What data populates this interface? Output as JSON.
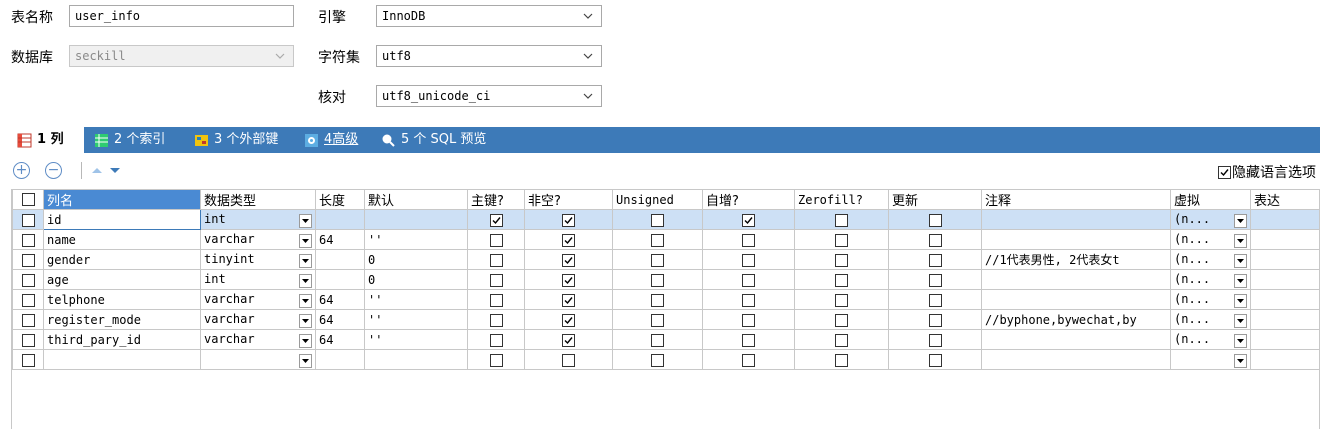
{
  "form": {
    "table_name_label": "表名称",
    "table_name_value": "user_info",
    "database_label": "数据库",
    "database_value": "seckill",
    "engine_label": "引擎",
    "engine_value": "InnoDB",
    "charset_label": "字符集",
    "charset_value": "utf8",
    "collation_label": "核对",
    "collation_value": "utf8_unicode_ci"
  },
  "tabs": [
    {
      "label": "1 列",
      "icon": "columns-icon"
    },
    {
      "label": "2 个索引",
      "icon": "index-icon"
    },
    {
      "label": "3 个外部键",
      "icon": "foreign-key-icon"
    },
    {
      "label": "4高级",
      "icon": "advanced-icon"
    },
    {
      "label": "5 个 SQL 预览",
      "icon": "search-icon"
    }
  ],
  "toolbar": {
    "add_glyph": "+",
    "remove_glyph": "−",
    "hide_lang_label": "隐藏语言选项"
  },
  "columns": [
    "列名",
    "数据类型",
    "长度",
    "默认",
    "主键?",
    "非空?",
    "Unsigned",
    "自增?",
    "Zerofill?",
    "更新",
    "注释",
    "虚拟",
    "表达"
  ],
  "rows": [
    {
      "name": "id",
      "type": "int",
      "length": "",
      "default": "",
      "pk": true,
      "notnull": true,
      "unsigned": false,
      "autoinc": true,
      "zerofill": false,
      "update": false,
      "comment": "",
      "virtual": "(n..."
    },
    {
      "name": "name",
      "type": "varchar",
      "length": "64",
      "default": "''",
      "pk": false,
      "notnull": true,
      "unsigned": false,
      "autoinc": false,
      "zerofill": false,
      "update": false,
      "comment": "",
      "virtual": "(n..."
    },
    {
      "name": "gender",
      "type": "tinyint",
      "length": "",
      "default": "0",
      "pk": false,
      "notnull": true,
      "unsigned": false,
      "autoinc": false,
      "zerofill": false,
      "update": false,
      "comment": "//1代表男性, 2代表女t",
      "virtual": "(n..."
    },
    {
      "name": "age",
      "type": "int",
      "length": "",
      "default": "0",
      "pk": false,
      "notnull": true,
      "unsigned": false,
      "autoinc": false,
      "zerofill": false,
      "update": false,
      "comment": "",
      "virtual": "(n..."
    },
    {
      "name": "telphone",
      "type": "varchar",
      "length": "64",
      "default": "''",
      "pk": false,
      "notnull": true,
      "unsigned": false,
      "autoinc": false,
      "zerofill": false,
      "update": false,
      "comment": "",
      "virtual": "(n..."
    },
    {
      "name": "register_mode",
      "type": "varchar",
      "length": "64",
      "default": "''",
      "pk": false,
      "notnull": true,
      "unsigned": false,
      "autoinc": false,
      "zerofill": false,
      "update": false,
      "comment": "//byphone,bywechat,by",
      "virtual": "(n..."
    },
    {
      "name": "third_pary_id",
      "type": "varchar",
      "length": "64",
      "default": "''",
      "pk": false,
      "notnull": true,
      "unsigned": false,
      "autoinc": false,
      "zerofill": false,
      "update": false,
      "comment": "",
      "virtual": "(n..."
    },
    {
      "name": "",
      "type": "",
      "length": "",
      "default": "",
      "pk": false,
      "notnull": false,
      "unsigned": false,
      "autoinc": false,
      "zerofill": false,
      "update": false,
      "comment": "",
      "virtual": ""
    }
  ],
  "colors": {
    "accent": "#3d7ab8",
    "selected_row": "#cde0f5",
    "header_highlight": "#4a8ad3"
  }
}
